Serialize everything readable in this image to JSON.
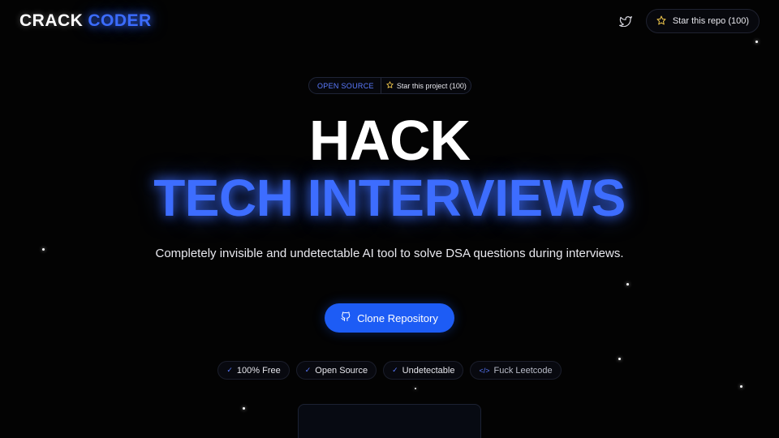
{
  "header": {
    "logo_word1": "CRACK",
    "logo_word2": "CODER",
    "twitter_icon": "twitter-icon",
    "star_repo_label": "Star this repo (100)"
  },
  "hero": {
    "pill_tag": "OPEN SOURCE",
    "pill_cta": "Star this project (100)",
    "line1": "HACK",
    "line2": "TECH INTERVIEWS",
    "subtitle": "Completely invisible and undetectable AI tool to solve DSA questions during interviews.",
    "cta_label": "Clone Repository",
    "cta_icon": "github-icon"
  },
  "badges": [
    {
      "icon": "✓",
      "label": "100% Free"
    },
    {
      "icon": "✓",
      "label": "Open Source"
    },
    {
      "icon": "✓",
      "label": "Undetectable"
    },
    {
      "icon": "</>",
      "label": "Fuck Leetcode"
    }
  ],
  "colors": {
    "accent": "#3d6dff",
    "button": "#1d5cf5",
    "background": "#030303"
  }
}
